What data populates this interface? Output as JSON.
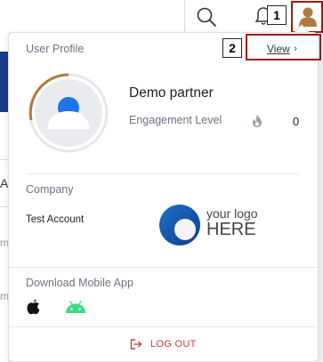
{
  "header": {
    "search_icon": "search-icon",
    "notification_icon": "bell-icon",
    "avatar_icon": "user-avatar-icon"
  },
  "annotations": [
    {
      "label": "1"
    },
    {
      "label": "2"
    }
  ],
  "page_background": {
    "letter_a": "A",
    "letter_m1": "m",
    "letter_m2": "m"
  },
  "profile": {
    "section_title": "User Profile",
    "view_label": "View",
    "view_chevron": "›",
    "name": "Demo partner",
    "engagement_label": "Engagement Level",
    "engagement_value": "0",
    "engagement_icon": "flame-icon"
  },
  "company": {
    "section_title": "Company",
    "name": "Test Account",
    "logo_line1": "your logo",
    "logo_line2": "HERE"
  },
  "mobile_app": {
    "section_title": "Download Mobile App",
    "apps": [
      "apple-icon",
      "android-icon"
    ]
  },
  "logout": {
    "label": "LOG OUT",
    "icon": "logout-icon"
  },
  "colors": {
    "accent_brown": "#b07a3a",
    "logout_red": "#d23a3a",
    "annotation_red": "#a31818",
    "logo_blue": "#1f6fc8",
    "android_green": "#3ddc84"
  }
}
